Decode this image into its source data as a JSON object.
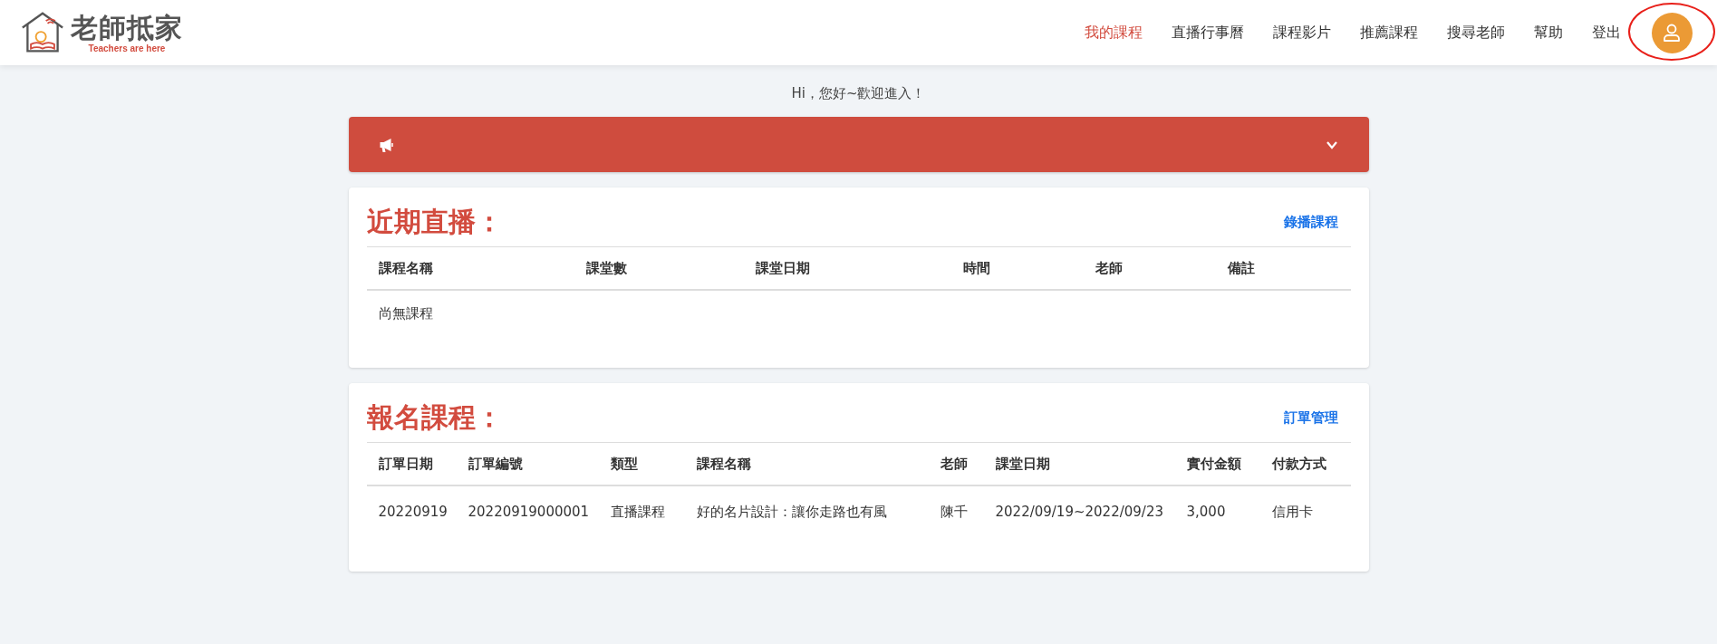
{
  "header": {
    "logo": {
      "title": "老師抵家",
      "tagline": "Teachers are here"
    },
    "nav": [
      {
        "label": "我的課程",
        "selected": true
      },
      {
        "label": "直播行事曆",
        "selected": false
      },
      {
        "label": "課程影片",
        "selected": false
      },
      {
        "label": "推薦課程",
        "selected": false
      },
      {
        "label": "搜尋老師",
        "selected": false
      },
      {
        "label": "幫助",
        "selected": false
      },
      {
        "label": "登出",
        "selected": false
      }
    ],
    "avatar": {
      "highlighted": true
    }
  },
  "welcome": "Hi，您好~歡迎進入！",
  "announcement": {
    "expanded": false
  },
  "sections": [
    {
      "title": "近期直播：",
      "link": "錄播課程",
      "columns": [
        "課程名稱",
        "課堂數",
        "課堂日期",
        "時間",
        "老師",
        "備註"
      ],
      "empty": "尚無課程"
    },
    {
      "title": "報名課程：",
      "link": "訂單管理",
      "columns": [
        "訂單日期",
        "訂單編號",
        "類型",
        "課程名稱",
        "老師",
        "課堂日期",
        "實付金額",
        "付款方式"
      ],
      "rows": [
        [
          "20220919",
          "20220919000001",
          "直播課程",
          "好的名片設計：讓你走路也有風",
          "陳千",
          "2022/09/19~2022/09/23",
          "3,000",
          "信用卡"
        ]
      ]
    }
  ]
}
